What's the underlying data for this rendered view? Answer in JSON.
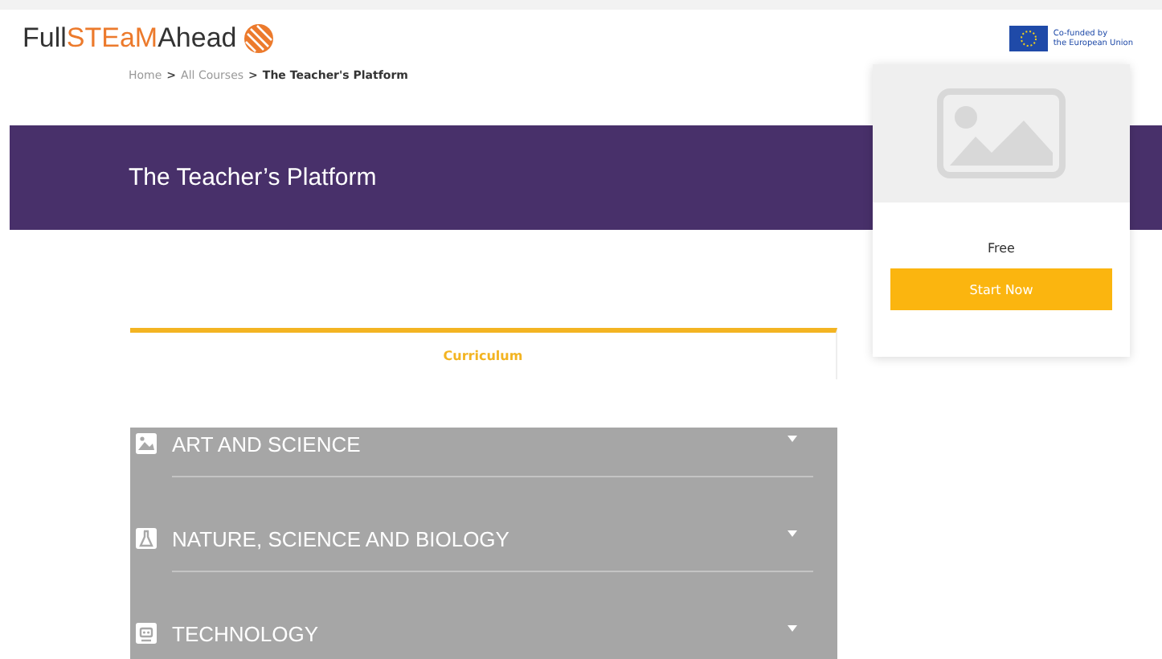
{
  "logo": {
    "prefix": "Full",
    "highlight": "STEaM",
    "suffix": "Ahead"
  },
  "eu_badge": {
    "line1": "Co-funded by",
    "line2": "the European Union"
  },
  "breadcrumb": {
    "separator": ">",
    "items": [
      {
        "label": "Home",
        "current": false
      },
      {
        "label": "All Courses",
        "current": false
      },
      {
        "label": "The Teacher's Platform",
        "current": true
      }
    ]
  },
  "banner": {
    "title": "The Teacher’s Platform"
  },
  "course_card": {
    "price": "Free",
    "button": "Start Now"
  },
  "tabs": [
    {
      "label": "Curriculum",
      "selected": true
    }
  ],
  "sections": [
    {
      "title": "ART AND SCIENCE",
      "expanded": false
    },
    {
      "title": "NATURE, SCIENCE AND BIOLOGY",
      "expanded": false
    },
    {
      "title": "TECHNOLOGY",
      "expanded": false
    }
  ]
}
